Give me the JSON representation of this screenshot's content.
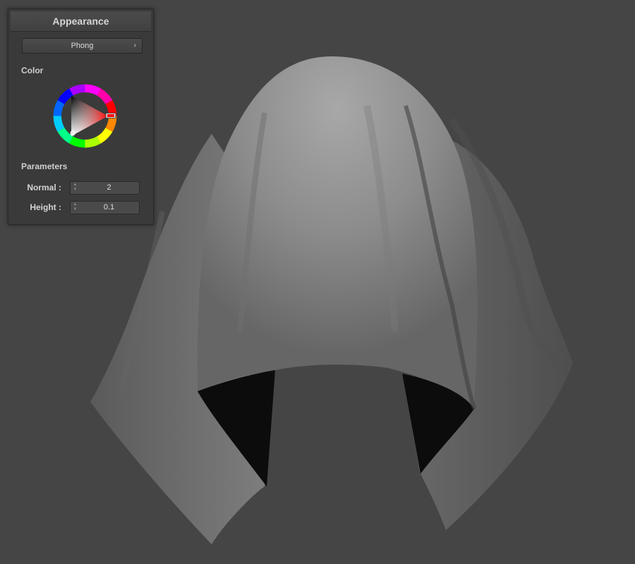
{
  "panel": {
    "title": "Appearance",
    "material_select": {
      "value": "Phong",
      "chevron": "›"
    },
    "color_section": {
      "label": "Color",
      "hue_color": "#ff0000"
    },
    "parameters_section": {
      "label": "Parameters",
      "normal": {
        "label": "Normal :",
        "value": "2"
      },
      "height": {
        "label": "Height :",
        "value": "0.1"
      }
    }
  },
  "viewport": {
    "background_color": "#454545",
    "model": "cloth-draped-over-sphere",
    "model_color": "#8a8a8a"
  }
}
